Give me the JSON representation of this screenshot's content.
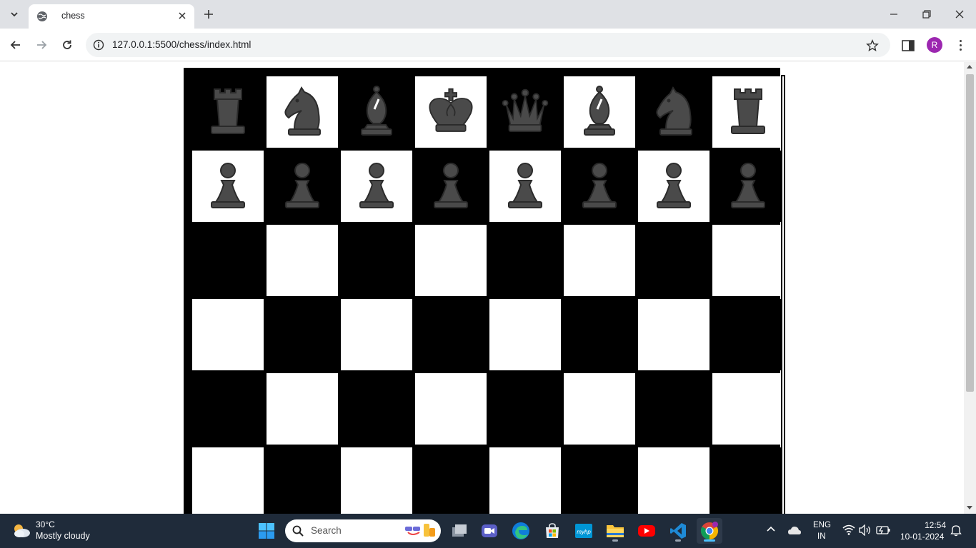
{
  "browser": {
    "tab_title": "chess",
    "url": "127.0.0.1:5500/chess/index.html",
    "profile_initial": "R",
    "accent": "#9c27b0"
  },
  "board": {
    "rows": [
      [
        "rook",
        "knight",
        "bishop",
        "king",
        "queen",
        "bishop",
        "knight",
        "rook"
      ],
      [
        "pawn",
        "pawn",
        "pawn",
        "pawn",
        "pawn",
        "pawn",
        "pawn",
        "pawn"
      ],
      [
        "",
        "",
        "",
        "",
        "",
        "",
        "",
        ""
      ],
      [
        "",
        "",
        "",
        "",
        "",
        "",
        "",
        ""
      ],
      [
        "",
        "",
        "",
        "",
        "",
        "",
        "",
        ""
      ],
      [
        "",
        "",
        "",
        "",
        "",
        "",
        "",
        ""
      ]
    ],
    "piece_color": "#4a4a4a",
    "light_color": "#ffffff",
    "dark_color": "#000000"
  },
  "taskbar": {
    "weather_temp": "30°C",
    "weather_desc": "Mostly cloudy",
    "search_placeholder": "Search",
    "lang_line1": "ENG",
    "lang_line2": "IN",
    "time": "12:54",
    "date": "10-01-2024",
    "pinned": [
      "file-explorer-widget-icon",
      "zoom-icon",
      "edge-icon",
      "store-icon",
      "myhp-icon",
      "folder-icon",
      "youtube-icon",
      "vscode-icon",
      "chrome-icon"
    ]
  }
}
